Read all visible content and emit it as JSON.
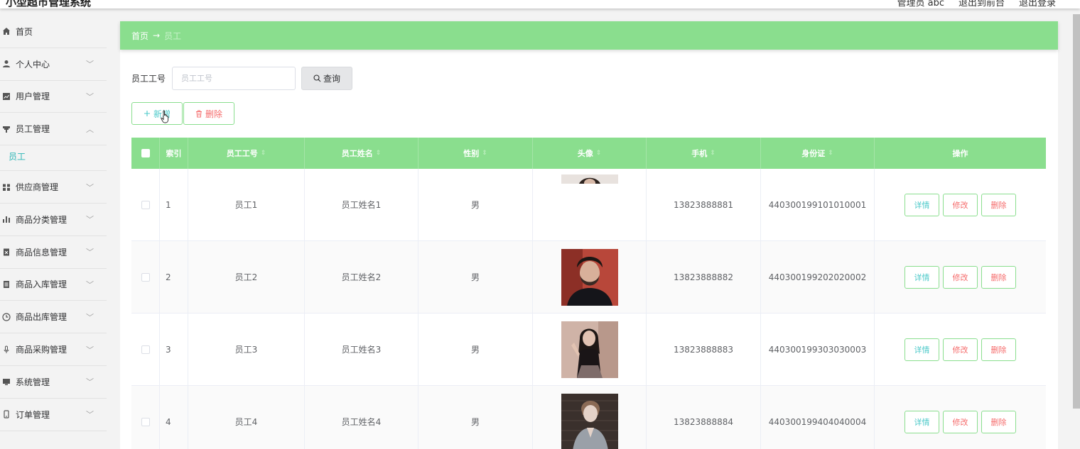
{
  "header": {
    "app_title": "小型超市管理系统",
    "user": "管理员 abc",
    "back_to_front": "退出到前台",
    "logout": "退出登录"
  },
  "sidebar": {
    "items": [
      {
        "label": "首页",
        "icon": "home-icon",
        "expandable": false
      },
      {
        "label": "个人中心",
        "icon": "user-icon",
        "expandable": true
      },
      {
        "label": "用户管理",
        "icon": "chart-icon",
        "expandable": true
      },
      {
        "label": "员工管理",
        "icon": "pin-icon",
        "expandable": true,
        "expanded": true
      },
      {
        "label": "供应商管理",
        "icon": "grid-icon",
        "expandable": true
      },
      {
        "label": "商品分类管理",
        "icon": "bar-chart-icon",
        "expandable": true
      },
      {
        "label": "商品信息管理",
        "icon": "clipboard-icon",
        "expandable": true
      },
      {
        "label": "商品入库管理",
        "icon": "document-icon",
        "expandable": true
      },
      {
        "label": "商品出库管理",
        "icon": "clock-icon",
        "expandable": true
      },
      {
        "label": "商品采购管理",
        "icon": "microphone-icon",
        "expandable": true
      },
      {
        "label": "系统管理",
        "icon": "monitor-icon",
        "expandable": true
      },
      {
        "label": "订单管理",
        "icon": "phone-icon",
        "expandable": true
      }
    ],
    "sub_item": "员工"
  },
  "breadcrumb": {
    "home": "首页",
    "arrow": "→",
    "current": "员工"
  },
  "search": {
    "label": "员工工号",
    "placeholder": "员工工号",
    "button": "查询"
  },
  "actions": {
    "add": "新增",
    "delete": "删除"
  },
  "table": {
    "headers": {
      "index": "索引",
      "emp_no": "员工工号",
      "emp_name": "员工姓名",
      "gender": "性别",
      "avatar": "头像",
      "phone": "手机",
      "id_card": "身份证",
      "ops": "操作"
    },
    "rows": [
      {
        "index": "1",
        "emp_no": "员工1",
        "emp_name": "员工姓名1",
        "gender": "男",
        "phone": "13823888881",
        "id_card": "440300199101010001"
      },
      {
        "index": "2",
        "emp_no": "员工2",
        "emp_name": "员工姓名2",
        "gender": "男",
        "phone": "13823888882",
        "id_card": "440300199202020002"
      },
      {
        "index": "3",
        "emp_no": "员工3",
        "emp_name": "员工姓名3",
        "gender": "男",
        "phone": "13823888883",
        "id_card": "440300199303030003"
      },
      {
        "index": "4",
        "emp_no": "员工4",
        "emp_name": "员工姓名4",
        "gender": "男",
        "phone": "13823888884",
        "id_card": "440300199404040004"
      }
    ],
    "row_buttons": {
      "view": "详情",
      "edit": "修改",
      "delete": "删除"
    }
  },
  "colors": {
    "accent_green": "#8ade8e",
    "teal_text": "#4cc9c9",
    "danger": "#f56c6c"
  }
}
